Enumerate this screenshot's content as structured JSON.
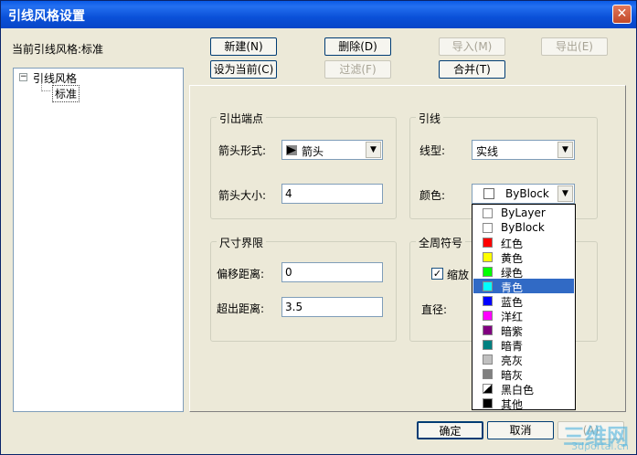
{
  "window": {
    "title": "引线风格设置",
    "close": "✕"
  },
  "current_style_label": "当前引线风格:标准",
  "toolbar": {
    "new": "新建(N)",
    "delete": "删除(D)",
    "import": "导入(M)",
    "export": "导出(E)",
    "set_current": "设为当前(C)",
    "filter": "过滤(F)",
    "merge": "合并(T)"
  },
  "tree": {
    "root": "引线风格",
    "child": "标准",
    "expander": "−"
  },
  "arrow_group": {
    "title": "引出端点",
    "style_label": "箭头形式:",
    "style_value": "箭头",
    "size_label": "箭头大小:",
    "size_value": "4"
  },
  "leader_group": {
    "title": "引线",
    "linetype_label": "线型:",
    "linetype_value": "实线",
    "color_label": "颜色:",
    "color_value": "ByBlock"
  },
  "dim_group": {
    "title": "尺寸界限",
    "offset_label": "偏移距离:",
    "offset_value": "0",
    "extend_label": "超出距离:",
    "extend_value": "3.5"
  },
  "around_group": {
    "title": "全周符号",
    "scale_label": "缩放",
    "diameter_label": "直径:"
  },
  "color_options": [
    {
      "label": "ByLayer",
      "color": "#ffffff"
    },
    {
      "label": "ByBlock",
      "color": "#ffffff"
    },
    {
      "label": "红色",
      "color": "#ff0000"
    },
    {
      "label": "黄色",
      "color": "#ffff00"
    },
    {
      "label": "绿色",
      "color": "#00ff00"
    },
    {
      "label": "青色",
      "color": "#00ffff"
    },
    {
      "label": "蓝色",
      "color": "#0000ff"
    },
    {
      "label": "洋红",
      "color": "#ff00ff"
    },
    {
      "label": "暗紫",
      "color": "#800080"
    },
    {
      "label": "暗青",
      "color": "#008080"
    },
    {
      "label": "亮灰",
      "color": "#c0c0c0"
    },
    {
      "label": "暗灰",
      "color": "#808080"
    },
    {
      "label": "黑白色",
      "color": "#000000"
    },
    {
      "label": "其他",
      "color": "#000000"
    }
  ],
  "selected_color_index": 5,
  "footer": {
    "ok": "确定",
    "cancel": "取消",
    "help": "(A)"
  },
  "watermark": {
    "main": "三维网",
    "sub": "3dportal.cn"
  }
}
